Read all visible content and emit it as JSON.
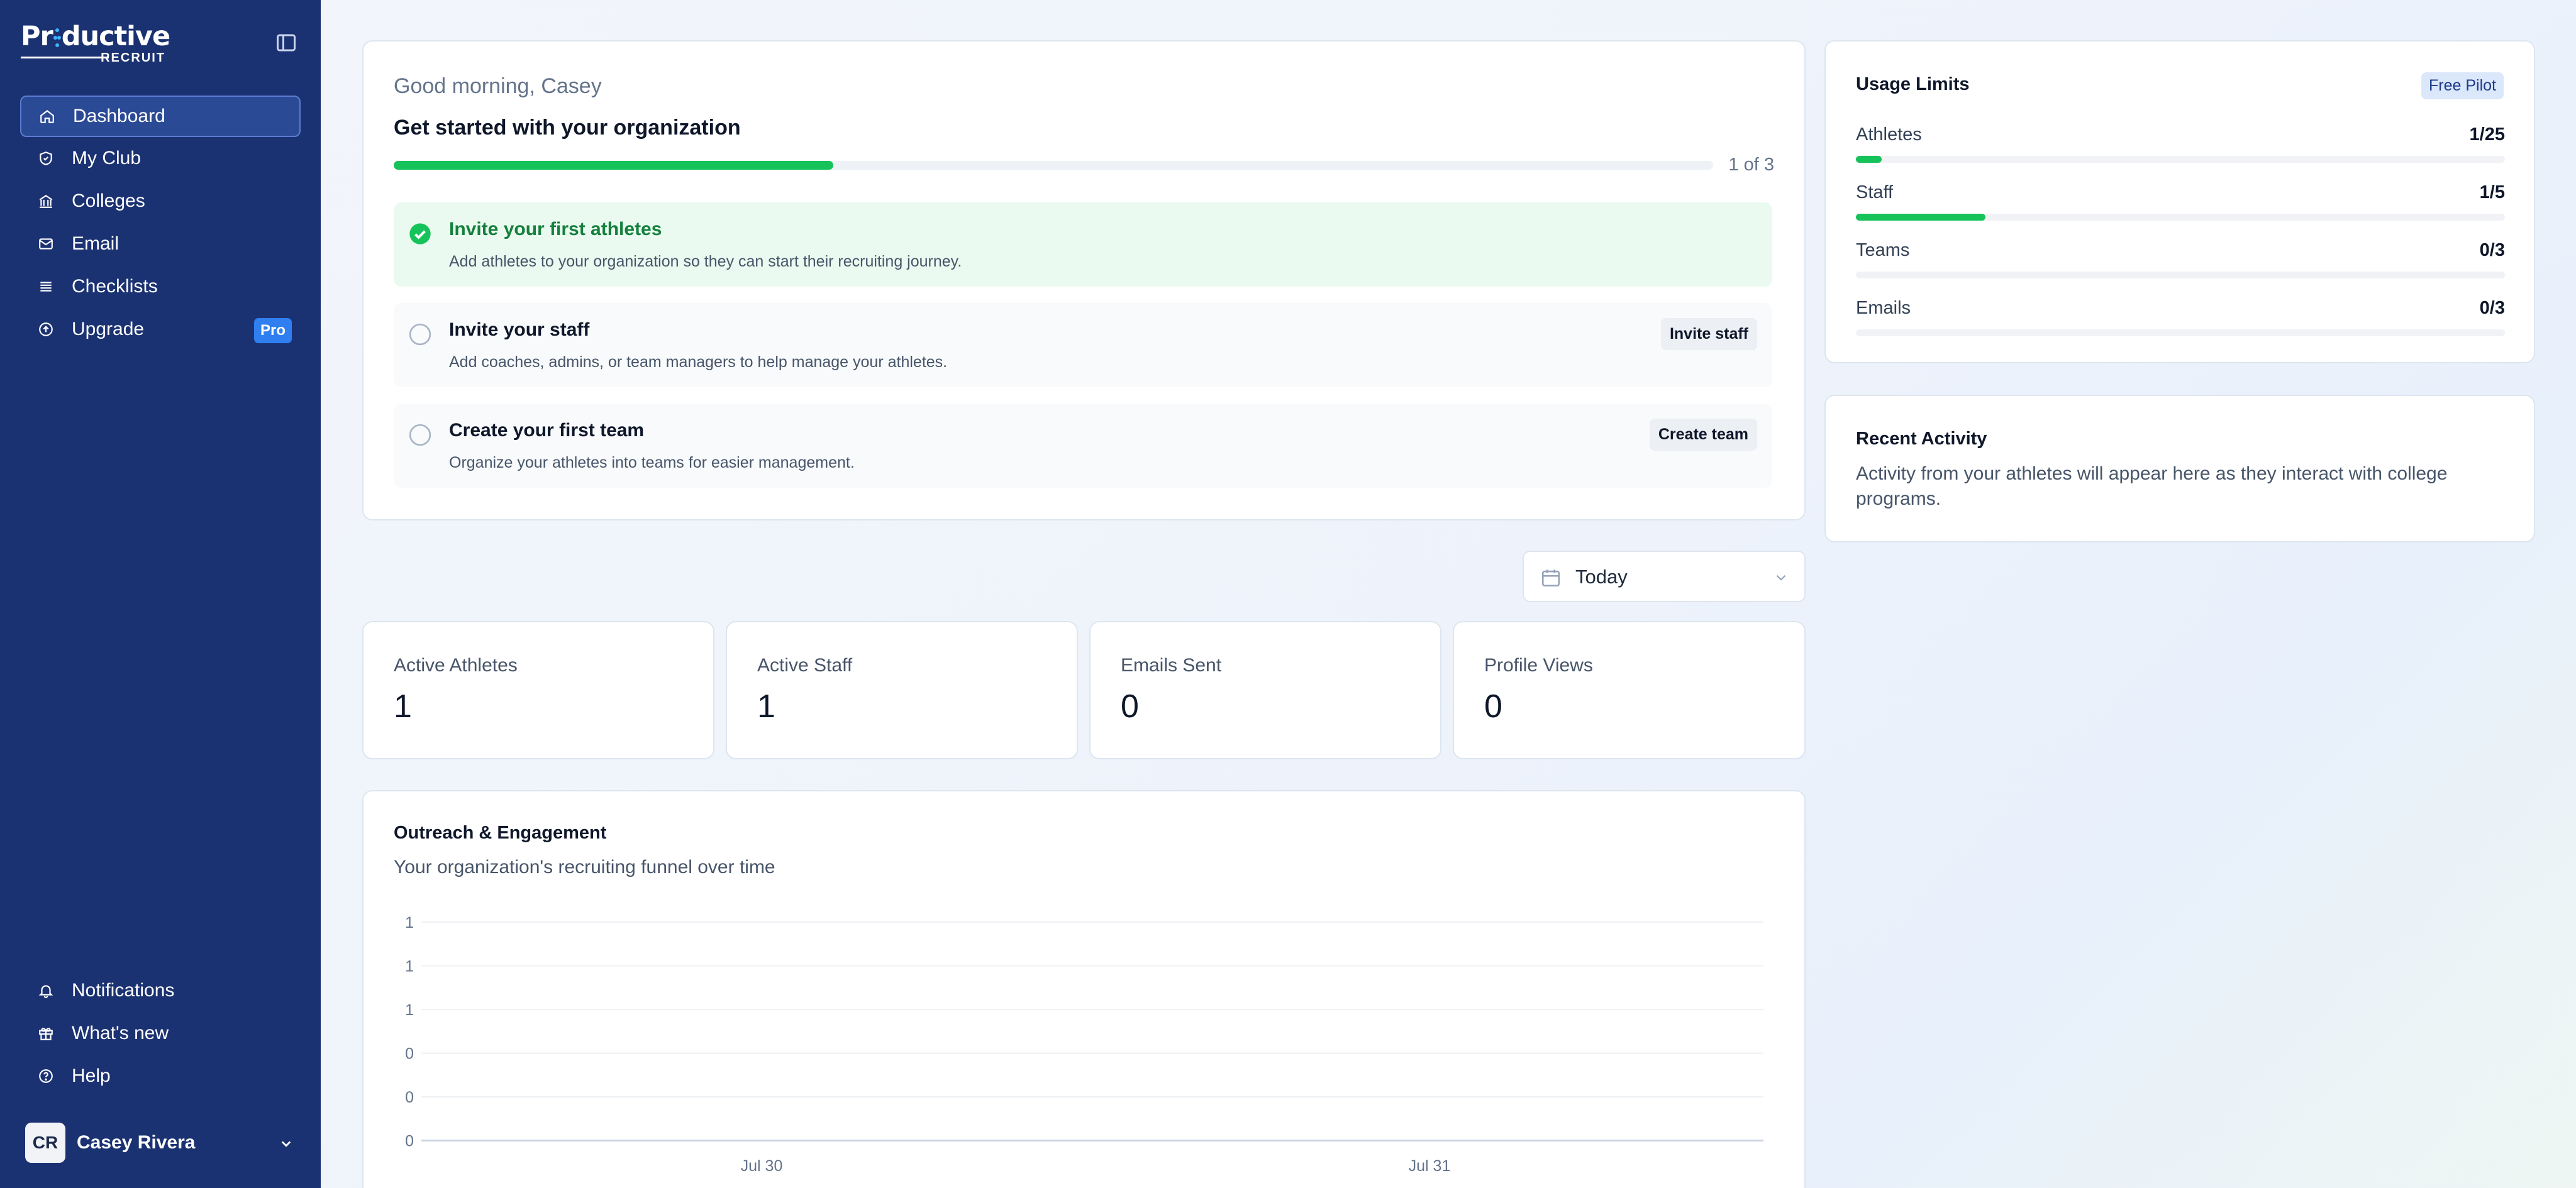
{
  "brand": {
    "name_pre": "Pr",
    "name_post": "ductive",
    "sub": "RECRUIT"
  },
  "sidebar": {
    "items": [
      {
        "label": "Dashboard",
        "icon": "home-icon",
        "active": true
      },
      {
        "label": "My Club",
        "icon": "shield-icon"
      },
      {
        "label": "Colleges",
        "icon": "building-icon"
      },
      {
        "label": "Email",
        "icon": "mail-icon"
      },
      {
        "label": "Checklists",
        "icon": "list-icon"
      },
      {
        "label": "Upgrade",
        "icon": "upgrade-icon",
        "badge": "Pro"
      }
    ],
    "bottom_items": [
      {
        "label": "Notifications",
        "icon": "bell-icon"
      },
      {
        "label": "What's new",
        "icon": "gift-icon"
      },
      {
        "label": "Help",
        "icon": "help-icon"
      }
    ],
    "user": {
      "initials": "CR",
      "name": "Casey Rivera"
    }
  },
  "getting_started": {
    "greeting": "Good morning, Casey",
    "title": "Get started with your organization",
    "progress_text": "1 of 3",
    "progress_fraction": 0.333,
    "tasks": [
      {
        "title": "Invite your first athletes",
        "desc": "Add athletes to your organization so they can start their recruiting journey.",
        "done": true,
        "button": ""
      },
      {
        "title": "Invite your staff",
        "desc": "Add coaches, admins, or team managers to help manage your athletes.",
        "done": false,
        "button": "Invite staff"
      },
      {
        "title": "Create your first team",
        "desc": "Organize your athletes into teams for easier management.",
        "done": false,
        "button": "Create team"
      }
    ]
  },
  "usage": {
    "title": "Usage Limits",
    "plan": "Free Pilot",
    "limits": [
      {
        "label": "Athletes",
        "value": "1/25",
        "fraction": 0.04
      },
      {
        "label": "Staff",
        "value": "1/5",
        "fraction": 0.2
      },
      {
        "label": "Teams",
        "value": "0/3",
        "fraction": 0
      },
      {
        "label": "Emails",
        "value": "0/3",
        "fraction": 0
      }
    ]
  },
  "recent_activity": {
    "title": "Recent Activity",
    "text": "Activity from your athletes will appear here as they interact with college programs."
  },
  "date_range": {
    "value": "Today"
  },
  "stats": [
    {
      "label": "Active Athletes",
      "value": "1"
    },
    {
      "label": "Active Staff",
      "value": "1"
    },
    {
      "label": "Emails Sent",
      "value": "0"
    },
    {
      "label": "Profile Views",
      "value": "0"
    }
  ],
  "outreach": {
    "title": "Outreach & Engagement",
    "subtitle": "Your organization's recruiting funnel over time"
  },
  "chart_data": {
    "type": "line",
    "title": "Outreach & Engagement",
    "subtitle": "Your organization's recruiting funnel over time",
    "xlabel": "",
    "ylabel": "",
    "x": [
      "Jul 30",
      "Jul 31"
    ],
    "y_tick_labels": [
      "1",
      "1",
      "1",
      "0",
      "0",
      "0"
    ],
    "series": [],
    "grid": true,
    "colors": {
      "grid": "#eef1f5",
      "axis": "#cbd5e1",
      "tick": "#64748b"
    }
  },
  "colors": {
    "sidebar_bg": "#1b3272",
    "accent_green": "#16c35a",
    "badge_blue": "#2f7ff0"
  }
}
